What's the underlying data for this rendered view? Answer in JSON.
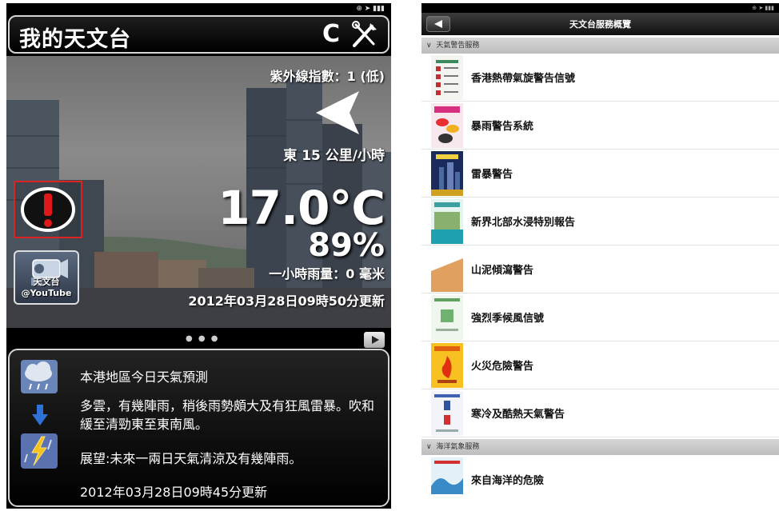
{
  "left_screen": {
    "app_title": "我的天文台",
    "refresh_icon": "refresh-icon",
    "tools_icon": "tools-icon",
    "uv_index": "紫外線指數：1 (低)",
    "wind": "東 15 公里/小時",
    "temperature": "17.0°C",
    "humidity": "89%",
    "rainfall": "一小時雨量：0 毫米",
    "obs_update": "2012年03月28日09時50分更新",
    "youtube_label": "天文台 @YouTube",
    "forecast": {
      "title": "本港地區今日天氣預測",
      "body": "多雲，有幾陣雨，稍後雨勢頗大及有狂風雷暴。吹和緩至清勁東至東南風。",
      "outlook": "展望:未來一兩日天氣清涼及有幾陣雨。",
      "update": "2012年03月28日09時45分更新"
    },
    "colors": {
      "warning_border": "#dd2222",
      "warning_icon": "#e01818"
    }
  },
  "right_screen": {
    "nav_title": "天文台服務概覽",
    "sections": [
      {
        "header": "天氣警告服務",
        "items": [
          {
            "label": "香港熱帶氣旋警告信號"
          },
          {
            "label": "暴雨警告系統"
          },
          {
            "label": "雷暴警告"
          },
          {
            "label": "新界北部水浸特別報告"
          },
          {
            "label": "山泥傾瀉警告"
          },
          {
            "label": "強烈季候風信號"
          },
          {
            "label": "火災危險警告"
          },
          {
            "label": "寒冷及酷熱天氣警告"
          }
        ]
      },
      {
        "header": "海洋氣象服務",
        "items": [
          {
            "label": "來自海洋的危險"
          }
        ]
      }
    ]
  }
}
